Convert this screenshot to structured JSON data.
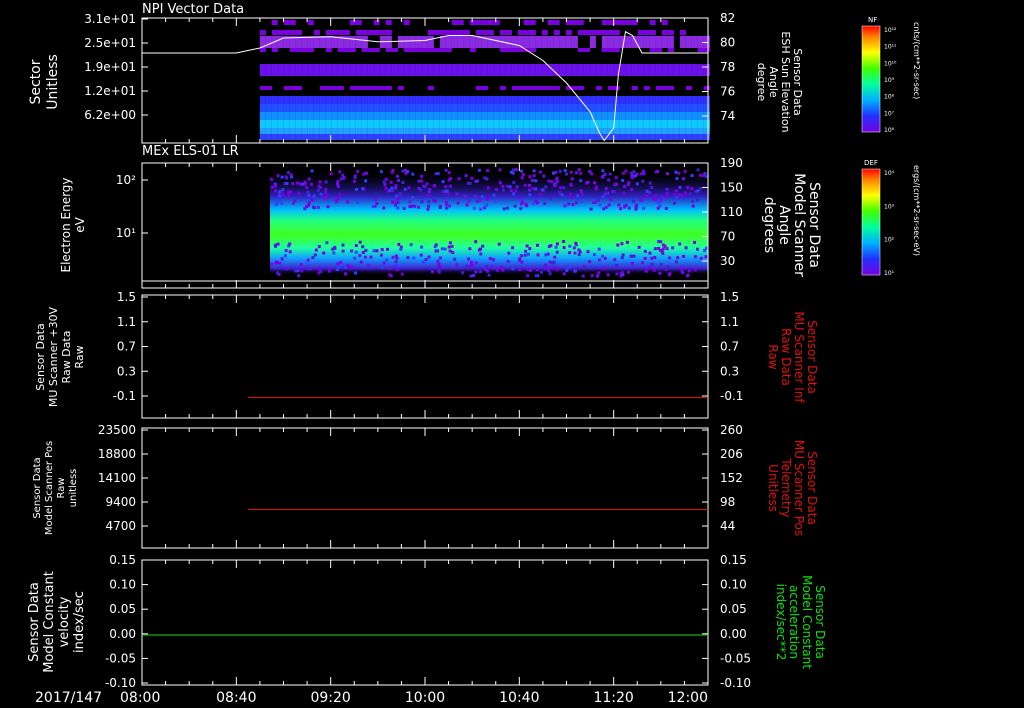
{
  "colors": {
    "background": "#000000",
    "axes": "#ffffff",
    "red": "#e01010",
    "green": "#10e010",
    "purple": "#8a2be2"
  },
  "panels": {
    "npi": {
      "title": "NPI Vector Data",
      "ylabel_line1": "Sector",
      "ylabel_line2": "Unitless",
      "right_label_lines": [
        "Sensor Data",
        "ESH Sun Elevation",
        "Angle",
        "degree"
      ],
      "yticks": [
        "3.1e+01",
        "2.5e+01",
        "1.9e+01",
        "1.2e+01",
        "6.2e+00"
      ],
      "right_ticks": [
        "82",
        "80",
        "78",
        "76",
        "74"
      ]
    },
    "els": {
      "title": "MEx ELS-01 LR",
      "ylabel_line1": "Electron Energy",
      "ylabel_line2": "eV",
      "right_label_lines": [
        "Sensor Data",
        "Model Scanner",
        "Angle",
        "degrees"
      ],
      "yticks": [
        "10²",
        "10¹"
      ],
      "right_ticks": [
        "190",
        "150",
        "110",
        "70",
        "30"
      ]
    },
    "mu_raw": {
      "left_label_lines": [
        "Sensor Data",
        "MU Scanner +30V",
        "Raw Data",
        "Raw"
      ],
      "right_label_lines": [
        "Sensor Data",
        "MU Scanner Inf",
        "Raw Data",
        "Raw"
      ],
      "yticks": [
        "1.5",
        "1.1",
        "0.7",
        "0.3",
        "-0.1"
      ],
      "right_ticks": [
        "1.5",
        "1.1",
        "0.7",
        "0.3",
        "-0.1"
      ]
    },
    "scanner_pos": {
      "left_label_lines": [
        "Sensor Data",
        "Model Scanner Pos",
        "Raw",
        "unitless"
      ],
      "right_label_lines": [
        "Sensor Data",
        "MU Scanner Pos",
        "Telemetry",
        "Unitless"
      ],
      "yticks": [
        "23500",
        "18800",
        "14100",
        "9400",
        "4700"
      ],
      "right_ticks": [
        "260",
        "206",
        "152",
        "98",
        "44"
      ]
    },
    "velocity": {
      "left_label_lines": [
        "Sensor Data",
        "Model Constant",
        "velocity",
        "index/sec"
      ],
      "right_label_lines": [
        "Sensor Data",
        "Model Constant",
        "acceleration",
        "index/sec**2"
      ],
      "yticks": [
        "0.15",
        "0.10",
        "0.05",
        "0.00",
        "-0.05",
        "-0.10"
      ],
      "right_ticks": [
        "0.15",
        "0.10",
        "0.05",
        "0.00",
        "-0.05",
        "-0.10"
      ]
    }
  },
  "colorbars": {
    "nf": {
      "label": "NF",
      "unit": "cnts/(cm**2-sr-sec)",
      "ticks": [
        "10¹²",
        "10¹¹",
        "10¹⁰",
        "10⁹",
        "10⁸",
        "10⁷",
        "10⁶"
      ]
    },
    "def": {
      "label": "DEF",
      "unit": "ergs/(cm**2-sr-sec-eV)",
      "ticks": [
        "10⁴",
        "10³",
        "10²",
        "10¹"
      ]
    }
  },
  "xaxis": {
    "date": "2017/147",
    "ticks": [
      "08:00",
      "08:40",
      "09:20",
      "10:00",
      "10:40",
      "11:20",
      "12:00"
    ]
  },
  "chart_data": [
    {
      "type": "heatmap",
      "title": "NPI Vector Data",
      "ylabel": "Sector Unitless",
      "xlim": [
        "08:00",
        "12:00"
      ],
      "data_start": "08:50",
      "series": [
        {
          "name": "Sensor Data ESH Sun Elevation Angle",
          "type": "line",
          "x": [
            "08:00",
            "08:40",
            "08:50",
            "09:00",
            "09:20",
            "09:40",
            "10:00",
            "10:10",
            "10:20",
            "10:40",
            "10:50",
            "11:00",
            "11:10",
            "11:14",
            "11:16",
            "11:20",
            "11:22",
            "11:25",
            "11:28",
            "11:32",
            "12:00"
          ],
          "y": [
            79.2,
            79.2,
            79.6,
            80.4,
            80.5,
            80.1,
            80.2,
            80.6,
            80.6,
            79.8,
            78.6,
            76.8,
            74.5,
            72.8,
            72.2,
            73.2,
            77.5,
            80.9,
            80.6,
            79.2,
            79.2
          ],
          "ylim": [
            72,
            82
          ]
        }
      ]
    },
    {
      "type": "heatmap",
      "title": "MEx ELS-01 LR",
      "ylabel": "Electron Energy eV",
      "xlim": [
        "08:00",
        "12:00"
      ],
      "data_start": "08:50",
      "series": [
        {
          "name": "Sensor Data Model Scanner Angle",
          "type": "line",
          "x": [
            "08:00",
            "12:00"
          ],
          "y": [
            20,
            20
          ],
          "ylim": [
            10,
            190
          ]
        }
      ]
    },
    {
      "type": "line",
      "xlim": [
        "08:00",
        "12:00"
      ],
      "ylim": [
        -0.3,
        1.5
      ],
      "series": [
        {
          "name": "Sensor Data MU Scanner Inf Raw Data Raw",
          "color": "#e01010",
          "x": [
            "08:45",
            "12:00"
          ],
          "y": [
            0,
            0
          ]
        }
      ]
    },
    {
      "type": "line",
      "xlim": [
        "08:00",
        "12:00"
      ],
      "ylim": [
        -5,
        260
      ],
      "series": [
        {
          "name": "Sensor Data MU Scanner Pos Telemetry Unitless",
          "color": "#e01010",
          "x": [
            "08:45",
            "12:00"
          ],
          "y": [
            80,
            80
          ]
        }
      ]
    },
    {
      "type": "line",
      "xlim": [
        "08:00",
        "12:00"
      ],
      "ylim": [
        -0.1,
        0.15
      ],
      "series": [
        {
          "name": "Sensor Data Model Constant velocity index/sec",
          "color": "#10e010",
          "x": [
            "08:00",
            "12:00"
          ],
          "y": [
            0,
            0
          ]
        }
      ]
    }
  ]
}
